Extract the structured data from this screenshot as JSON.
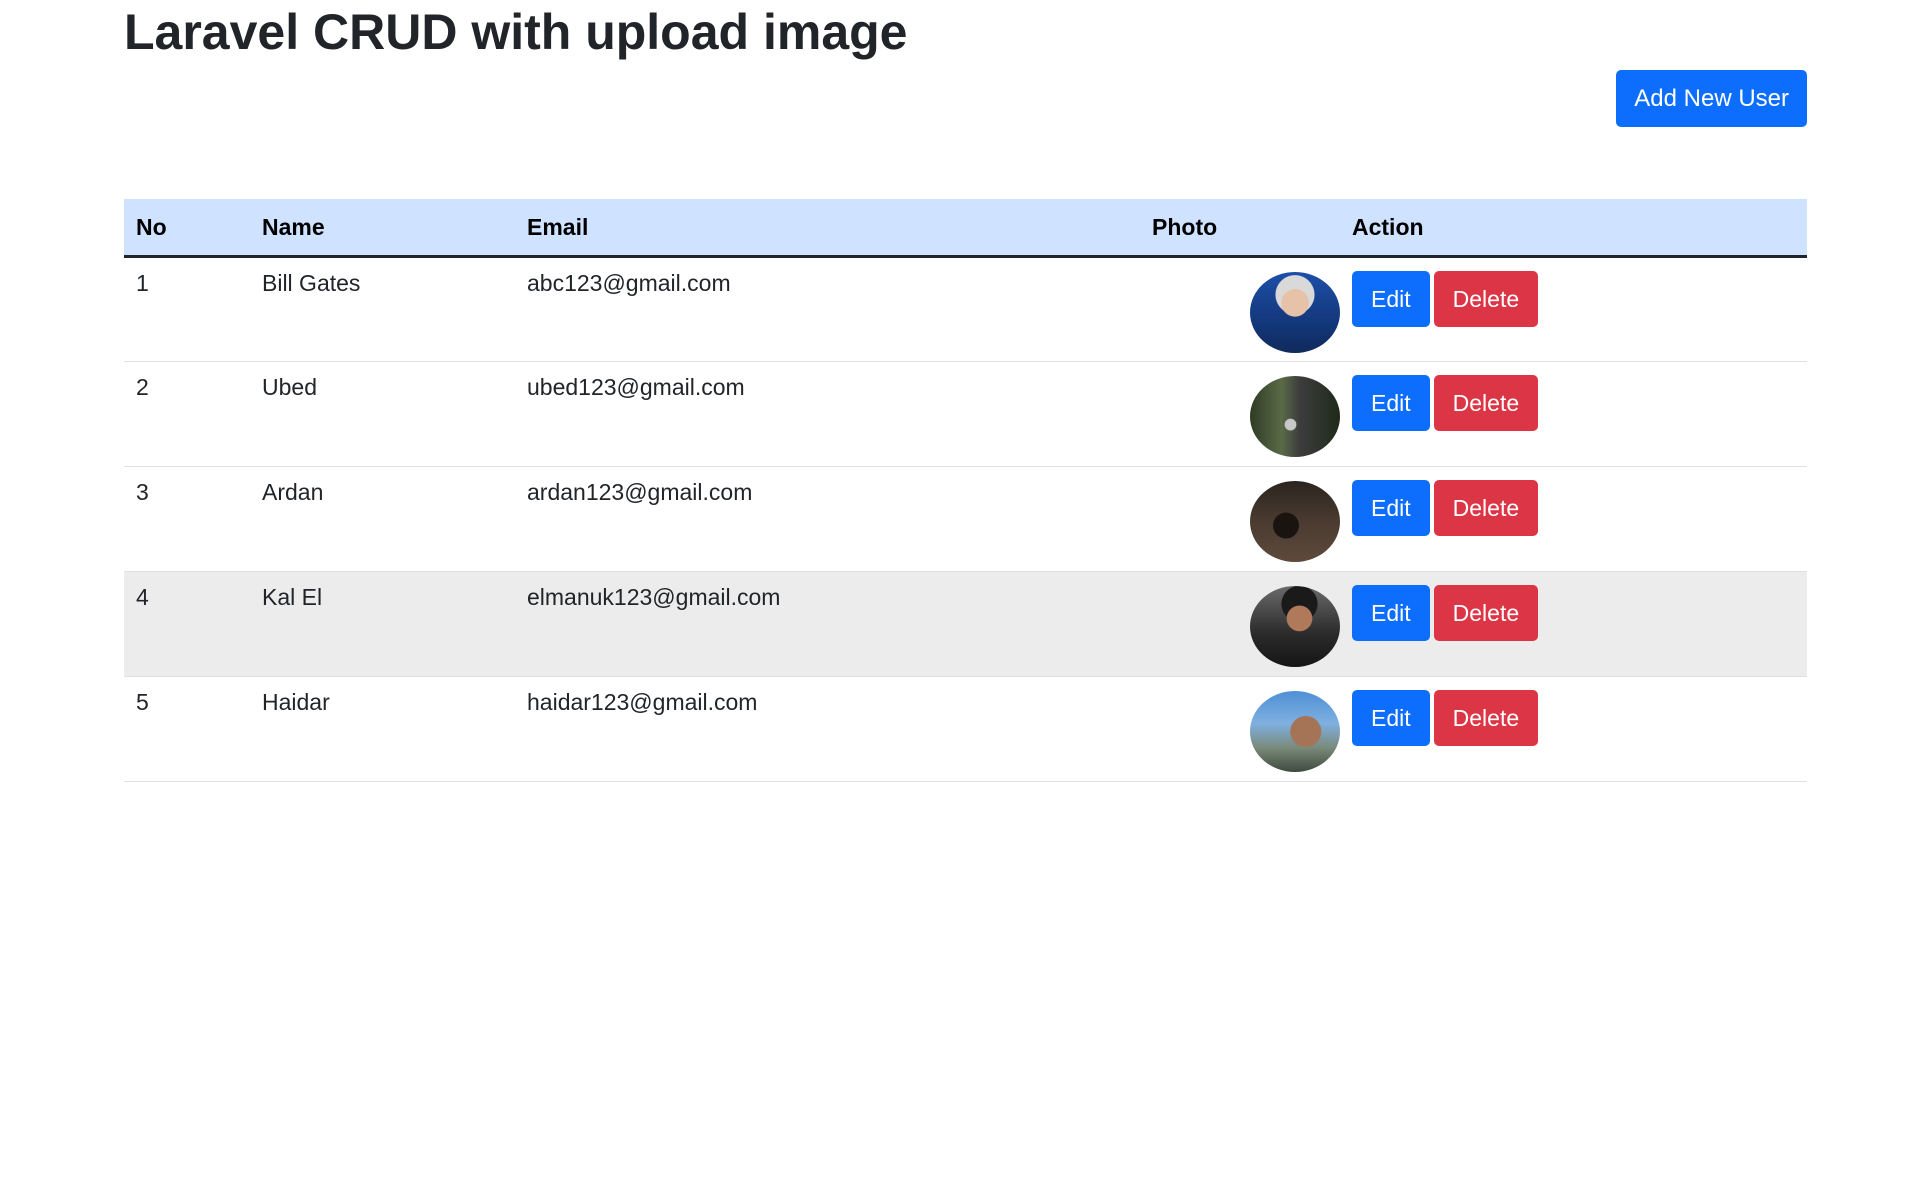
{
  "page": {
    "title": "Laravel CRUD with upload image",
    "add_button_label": "Add New User"
  },
  "colors": {
    "primary": "#0d6efd",
    "danger": "#dc3545",
    "header_bg": "#cfe2ff",
    "hover_row_bg": "#ececec"
  },
  "table": {
    "headers": {
      "no": "No",
      "name": "Name",
      "email": "Email",
      "photo": "Photo",
      "action": "Action"
    },
    "rows": [
      {
        "no": "1",
        "name": "Bill Gates",
        "email": "abc123@gmail.com",
        "edit_label": "Edit",
        "delete_label": "Delete"
      },
      {
        "no": "2",
        "name": "Ubed",
        "email": "ubed123@gmail.com",
        "edit_label": "Edit",
        "delete_label": "Delete"
      },
      {
        "no": "3",
        "name": "Ardan",
        "email": "ardan123@gmail.com",
        "edit_label": "Edit",
        "delete_label": "Delete"
      },
      {
        "no": "4",
        "name": "Kal El",
        "email": "elmanuk123@gmail.com",
        "edit_label": "Edit",
        "delete_label": "Delete"
      },
      {
        "no": "5",
        "name": "Haidar",
        "email": "haidar123@gmail.com",
        "edit_label": "Edit",
        "delete_label": "Delete"
      }
    ]
  }
}
